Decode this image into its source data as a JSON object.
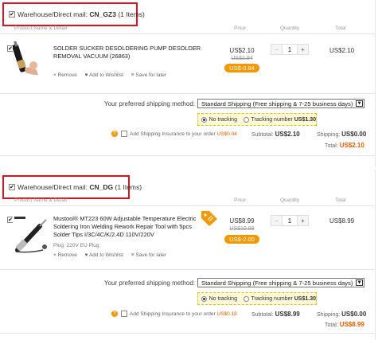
{
  "columns": {
    "product": "Product Name & Detail",
    "price": "Price",
    "quantity": "Quantity",
    "total": "Total"
  },
  "actions": {
    "remove": "Remove",
    "wishlist": "Add to Wishlist",
    "save_later": "Save for later"
  },
  "shipping_label": "Your preferred shipping method:",
  "tracking": {
    "no_tracking": "No tracking",
    "tracking_number_label": "Tracking number",
    "tracking_number_price": "US$1.30"
  },
  "insurance_label": "Add Shipping Insurance to your order",
  "subtotal_label": "Subtotal:",
  "shipping_cost_label": "Shipping:",
  "total_label": "Total:",
  "colors": {
    "highlight_border": "#d9131f",
    "discount_badge": "#f39800",
    "total_price": "#f05a00"
  },
  "groups": [
    {
      "warehouse_label": "Warehouse/Direct mail:",
      "warehouse_code": "CN_GZ3",
      "item_count": "(1 Items)",
      "product": {
        "title": "SOLDER SUCKER DESOLDERING PUMP DESOLDER REMOVAL VACUUM (26863)",
        "plug": "",
        "price": "US$2.10",
        "old_price": "US$2.94",
        "discount": "US$-0.84",
        "quantity": "1",
        "line_total": "US$2.10"
      },
      "shipping_method": "Standard Shipping (Free shipping & 7-25 business days)",
      "insurance_price": "US$0.04",
      "subtotal": "US$2.10",
      "shipping": "US$0.00",
      "total": "US$2.10"
    },
    {
      "warehouse_label": "Warehouse/Direct mail:",
      "warehouse_code": "CN_DG",
      "item_count": "(1 Items)",
      "product": {
        "title": "Mustool® MT223 60W Adjustable Temperature Electric Soldering Iron Welding Rework Repair Tool with 5pcs Solder Tips I/3C/4C/K/2.4D 110V/220V",
        "plug": "Plug: 220V EU Plug",
        "price": "US$8.99",
        "old_price": "US$10.99",
        "discount": "US$-2.00",
        "quantity": "1",
        "line_total": "US$8.99"
      },
      "shipping_method": "Standard Shipping (Free shipping & 7-25 business days)",
      "insurance_price": "US$0.18",
      "subtotal": "US$8.99",
      "shipping": "US$0.00",
      "total": "US$8.99"
    }
  ]
}
